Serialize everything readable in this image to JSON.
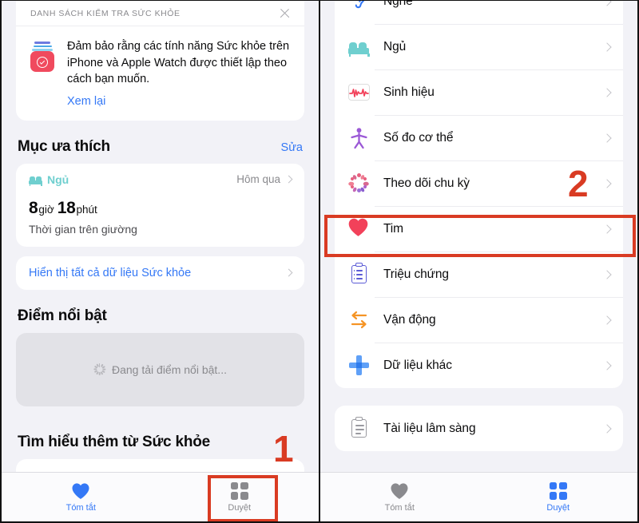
{
  "left_screen": {
    "checklist": {
      "title": "DANH SÁCH KIỂM TRA SỨC KHỎE",
      "message": "Đảm bảo rằng các tính năng Sức khỏe trên iPhone và Apple Watch được thiết lập theo cách bạn muốn.",
      "link": "Xem lại",
      "close_icon": "close-icon",
      "icon": "health-checklist-icon"
    },
    "favorites": {
      "title": "Mục ưa thích",
      "action": "Sửa",
      "card": {
        "category": "Ngủ",
        "category_icon": "bed-icon",
        "timestamp": "Hôm qua",
        "value_hours": "8",
        "unit_hours": "giờ",
        "value_minutes": "18",
        "unit_minutes": "phút",
        "subtitle": "Thời gian trên giường"
      },
      "show_all": "Hiển thị tất cả dữ liệu Sức khỏe"
    },
    "highlights": {
      "title": "Điểm nổi bật",
      "loading_text": "Đang tải điểm nổi bật...",
      "loading_icon": "spinner-icon"
    },
    "learn_more": {
      "title": "Tìm hiểu thêm từ Sức khỏe"
    },
    "tabbar": {
      "tabs": [
        {
          "label": "Tóm tắt",
          "icon": "heart-icon",
          "state": "active",
          "color": "#3478f6"
        },
        {
          "label": "Duyệt",
          "icon": "grid-icon",
          "state": "inactive",
          "color": "#8a8a8e"
        }
      ]
    },
    "annotation": {
      "number": "1"
    }
  },
  "right_screen": {
    "list_primary": [
      {
        "label": "Nghe",
        "icon": "ear-icon",
        "color": "#3478f6"
      },
      {
        "label": "Ngủ",
        "icon": "bed-icon",
        "color": "#6fcfcf"
      },
      {
        "label": "Sinh hiệu",
        "icon": "vitals-icon",
        "color": "#f2415a"
      },
      {
        "label": "Số đo cơ thể",
        "icon": "body-measurements-icon",
        "color": "#9b59d6"
      },
      {
        "label": "Theo dõi chu kỳ",
        "icon": "cycle-tracking-icon",
        "color": "#e8607f"
      },
      {
        "label": "Tim",
        "icon": "heart-icon",
        "color": "#f2415a"
      },
      {
        "label": "Triệu chứng",
        "icon": "symptoms-clipboard-icon",
        "color": "#5b5bd6"
      },
      {
        "label": "Vận động",
        "icon": "mobility-arrows-icon",
        "color": "#f59425"
      },
      {
        "label": "Dữ liệu khác",
        "icon": "other-data-plus-icon",
        "color": "#5fa0f7"
      }
    ],
    "list_secondary": [
      {
        "label": "Tài liệu lâm sàng",
        "icon": "clinical-documents-icon",
        "color": "#9a9aa0"
      }
    ],
    "tabbar": {
      "tabs": [
        {
          "label": "Tóm tắt",
          "icon": "heart-icon",
          "state": "inactive",
          "color": "#8a8a8e"
        },
        {
          "label": "Duyệt",
          "icon": "grid-icon",
          "state": "active",
          "color": "#3478f6"
        }
      ]
    },
    "annotation": {
      "number": "2"
    }
  }
}
